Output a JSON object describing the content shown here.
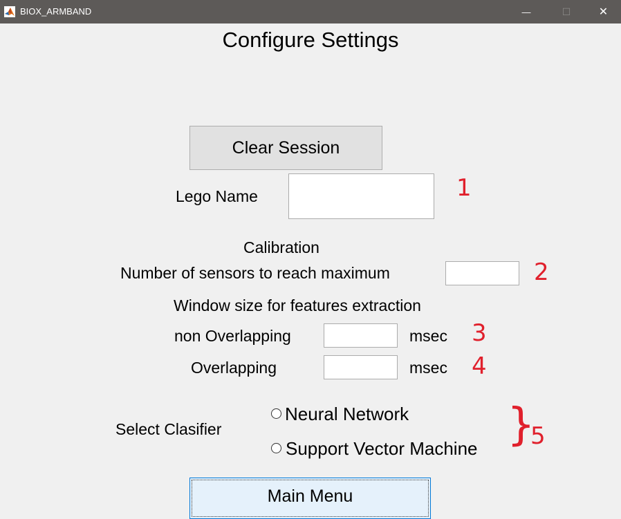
{
  "window": {
    "title": "BIOX_ARMBAND",
    "minimize_glyph": "—",
    "maximize_glyph": "☐",
    "close_glyph": "✕"
  },
  "page": {
    "title": "Configure Settings"
  },
  "clear_session": {
    "label": "Clear Session"
  },
  "lego": {
    "label": "Lego Name",
    "value": ""
  },
  "calibration": {
    "heading": "Calibration",
    "sensors_label": "Number of sensors to reach maximum",
    "sensors_value": ""
  },
  "window_size": {
    "heading": "Window size for features extraction",
    "non_overlapping_label": "non Overlapping",
    "non_overlapping_value": "",
    "overlapping_label": "Overlapping",
    "overlapping_value": "",
    "unit": "msec"
  },
  "classifier": {
    "label": "Select Clasifier",
    "options": [
      "Neural Network",
      "Support Vector Machine"
    ],
    "selected": null
  },
  "main_menu": {
    "label": "Main Menu"
  },
  "annotations": {
    "marks": [
      "1",
      "2",
      "3",
      "4",
      "5"
    ],
    "brace": "}",
    "color": "#e0202c"
  }
}
